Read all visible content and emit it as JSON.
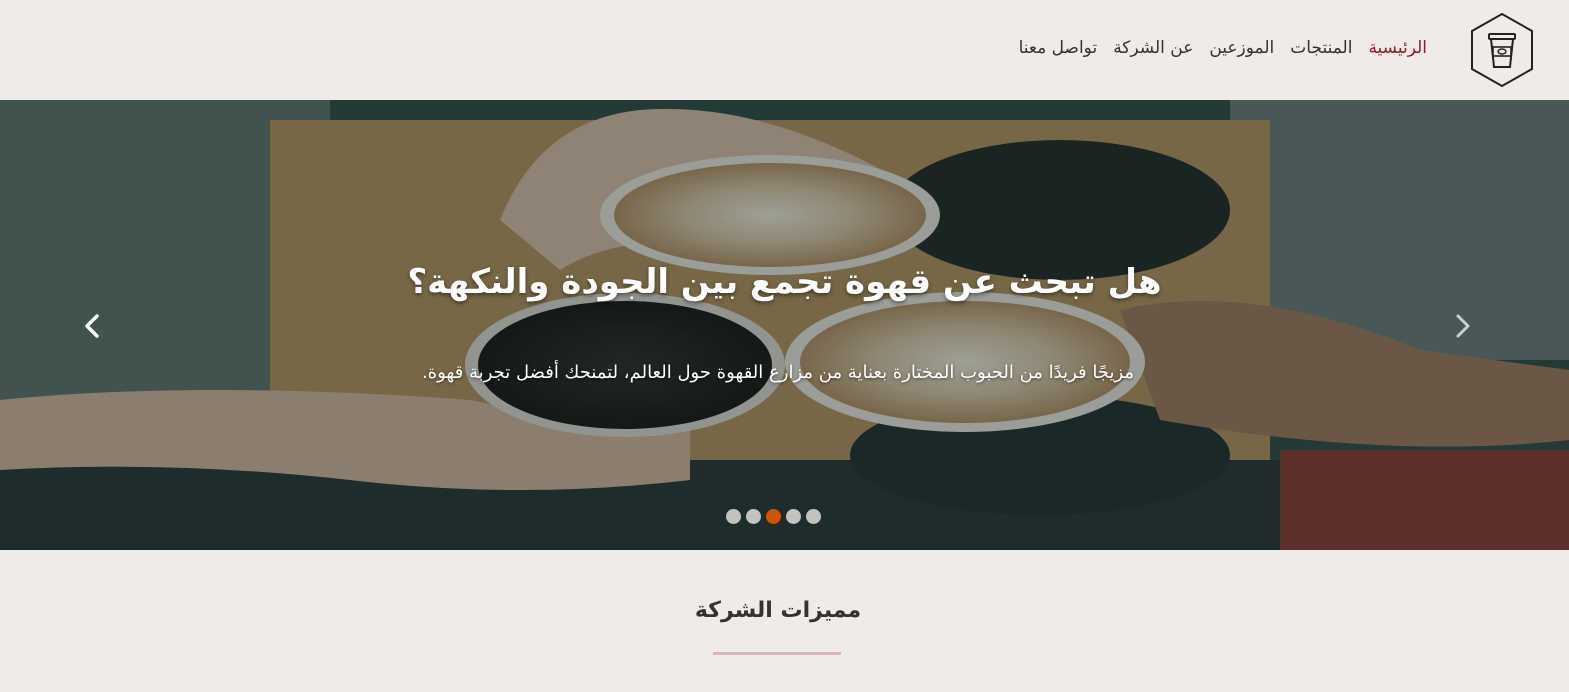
{
  "header": {
    "logo_icon": "coffee-cup-hexagon-icon",
    "nav": [
      {
        "label": "الرئيسية",
        "active": true
      },
      {
        "label": "المنتجات",
        "active": false
      },
      {
        "label": "الموزعين",
        "active": false
      },
      {
        "label": "عن الشركة",
        "active": false
      },
      {
        "label": "تواصل معنا",
        "active": false
      }
    ]
  },
  "hero": {
    "title": "هل تبحث عن قهوة تجمع بين الجودة والنكهة؟",
    "text": "مزيجًا فريدًا من الحبوب المختارة بعناية من مزارع القهوة حول العالم، لتمنحك أفضل تجربة قهوة.",
    "prev_icon": "chevron-left-icon",
    "next_icon": "chevron-right-icon",
    "slides_count": 5,
    "active_slide": 4
  },
  "features": {
    "title": "مميزات الشركة"
  },
  "colors": {
    "background": "#efebe8",
    "nav_active": "#8b1a2a",
    "dot_active": "#d35400",
    "divider": "#d8b5b8"
  }
}
